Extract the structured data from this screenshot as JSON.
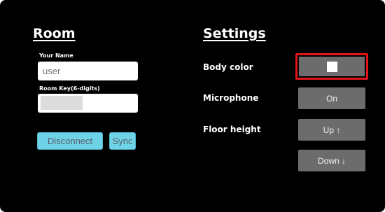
{
  "room": {
    "title": "Room",
    "name_label": "Your Name",
    "name_placeholder": "user",
    "key_label": "Room Key(6-digits)",
    "disconnect_label": "Disconnect",
    "sync_label": "Sync"
  },
  "settings": {
    "title": "Settings",
    "body_color_label": "Body color",
    "body_color_value": "#ffffff",
    "microphone_label": "Microphone",
    "microphone_button": "On",
    "floor_height_label": "Floor height",
    "up_button": "Up ↑",
    "down_button": "Down ↓"
  },
  "colors": {
    "background": "#000000",
    "accent_cyan": "#6fd3e8",
    "button_gray": "#6c6c6c",
    "selection_red": "#e0161b"
  }
}
